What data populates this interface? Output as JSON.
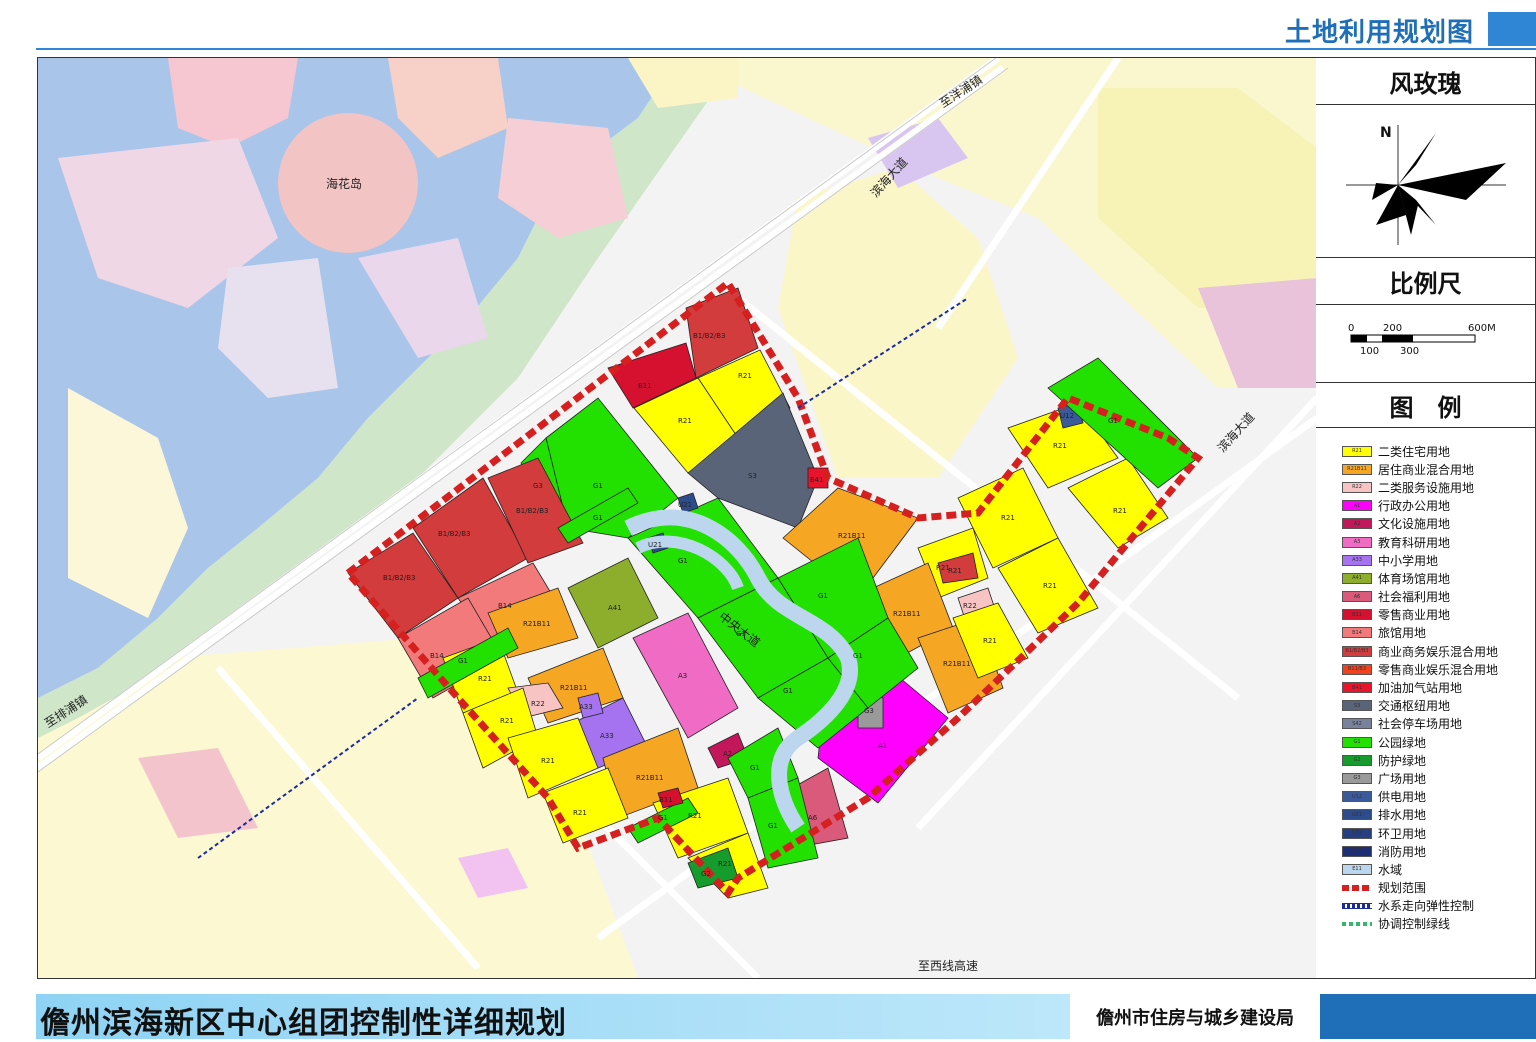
{
  "header": {
    "title": "土地利用规划图"
  },
  "panel": {
    "wind_title": "风玫瑰",
    "north_label": "N",
    "scale_title": "比例尺",
    "scale_labels": {
      "zero": "0",
      "two_hundred": "200",
      "six_hundred": "600M",
      "one_hundred": "100",
      "three_hundred": "300"
    },
    "legend_title": "图　例",
    "legend": [
      {
        "code": "R21",
        "label": "二类住宅用地",
        "color": "#ffff00"
      },
      {
        "code": "R21B11",
        "label": "居住商业混合用地",
        "color": "#f5a623"
      },
      {
        "code": "R22",
        "label": "二类服务设施用地",
        "color": "#f7c3c3"
      },
      {
        "code": "A1",
        "label": "行政办公用地",
        "color": "#ff00ff"
      },
      {
        "code": "A2",
        "label": "文化设施用地",
        "color": "#c2185b"
      },
      {
        "code": "A3",
        "label": "教育科研用地",
        "color": "#f06bc4"
      },
      {
        "code": "A33",
        "label": "中小学用地",
        "color": "#a572f0"
      },
      {
        "code": "A41",
        "label": "体育场馆用地",
        "color": "#8cae2c"
      },
      {
        "code": "A6",
        "label": "社会福利用地",
        "color": "#d95a7a"
      },
      {
        "code": "B11",
        "label": "零售商业用地",
        "color": "#d6102f"
      },
      {
        "code": "B14",
        "label": "旅馆用地",
        "color": "#f37a7a"
      },
      {
        "code": "B1/B2/B3",
        "label": "商业商务娱乐混合用地",
        "color": "#d23c3c"
      },
      {
        "code": "B11/B3",
        "label": "零售商业娱乐混合用地",
        "color": "#f0421e"
      },
      {
        "code": "B41",
        "label": "加油加气站用地",
        "color": "#e8142c"
      },
      {
        "code": "S3",
        "label": "交通枢纽用地",
        "color": "#5a6478"
      },
      {
        "code": "S42",
        "label": "社会停车场用地",
        "color": "#78829a"
      },
      {
        "code": "G1",
        "label": "公园绿地",
        "color": "#22e000"
      },
      {
        "code": "G2",
        "label": "防护绿地",
        "color": "#159c2c"
      },
      {
        "code": "G3",
        "label": "广场用地",
        "color": "#9a9a9a"
      },
      {
        "code": "U12",
        "label": "供电用地",
        "color": "#3a5a9a"
      },
      {
        "code": "U21",
        "label": "排水用地",
        "color": "#2d4c8c"
      },
      {
        "code": "U22",
        "label": "环卫用地",
        "color": "#253f80"
      },
      {
        "code": "U31",
        "label": "消防用地",
        "color": "#1c2f74"
      },
      {
        "code": "E11",
        "label": "水域",
        "color": "#bcd6ee"
      },
      {
        "code": "",
        "label": "规划范围",
        "color": "#d62020"
      },
      {
        "code": "",
        "label": "水系走向弹性控制",
        "color": "#1a2c9e"
      },
      {
        "code": "",
        "label": "协调控制绿线",
        "color": "#32b86a"
      }
    ]
  },
  "map": {
    "place_labels": {
      "island": "海花岛",
      "road_ne_top": "至洋浦镇",
      "road_sw": "至排浦镇",
      "road_south": "至西线高速",
      "road_binhai_1": "滨海大道",
      "road_binhai_2": "滨海大道",
      "avenue_center": "中央大道"
    },
    "parcels": [
      {
        "code": "B1/B2/B3"
      },
      {
        "code": "B11"
      },
      {
        "code": "R21"
      },
      {
        "code": "R21"
      },
      {
        "code": "G1"
      },
      {
        "code": "G3"
      },
      {
        "code": "B1/B2/B3"
      },
      {
        "code": "B1/B2/B3"
      },
      {
        "code": "B1/B2/B3"
      },
      {
        "code": "B14"
      },
      {
        "code": "B14"
      },
      {
        "code": "S3"
      },
      {
        "code": "B41"
      },
      {
        "code": "R21B11"
      },
      {
        "code": "A41"
      },
      {
        "code": "A3"
      },
      {
        "code": "R21B11"
      },
      {
        "code": "R21B11"
      },
      {
        "code": "A33"
      },
      {
        "code": "R21B11"
      },
      {
        "code": "R21"
      },
      {
        "code": "R22"
      },
      {
        "code": "R21"
      },
      {
        "code": "R21"
      },
      {
        "code": "R21"
      },
      {
        "code": "R21"
      },
      {
        "code": "R21"
      },
      {
        "code": "A2"
      },
      {
        "code": "A6"
      },
      {
        "code": "A1"
      },
      {
        "code": "G3"
      },
      {
        "code": "R21"
      },
      {
        "code": "R21"
      },
      {
        "code": "R21"
      },
      {
        "code": "R21"
      },
      {
        "code": "R21"
      },
      {
        "code": "R21B11"
      },
      {
        "code": "R21B11"
      },
      {
        "code": "R22"
      },
      {
        "code": "R21"
      },
      {
        "code": "R21"
      },
      {
        "code": "U12"
      },
      {
        "code": "G1"
      },
      {
        "code": "G1"
      },
      {
        "code": "G1"
      },
      {
        "code": "G1"
      },
      {
        "code": "G1"
      },
      {
        "code": "G1"
      },
      {
        "code": "G1"
      },
      {
        "code": "G1"
      },
      {
        "code": "G1"
      },
      {
        "code": "G1"
      },
      {
        "code": "G1"
      },
      {
        "code": "G2"
      },
      {
        "code": "U21"
      },
      {
        "code": "U21"
      },
      {
        "code": "A33"
      },
      {
        "code": "B11"
      }
    ]
  },
  "footer": {
    "plan_title": "儋州滨海新区中心组团控制性详细规划",
    "bureau": "儋州市住房与城乡建设局"
  }
}
